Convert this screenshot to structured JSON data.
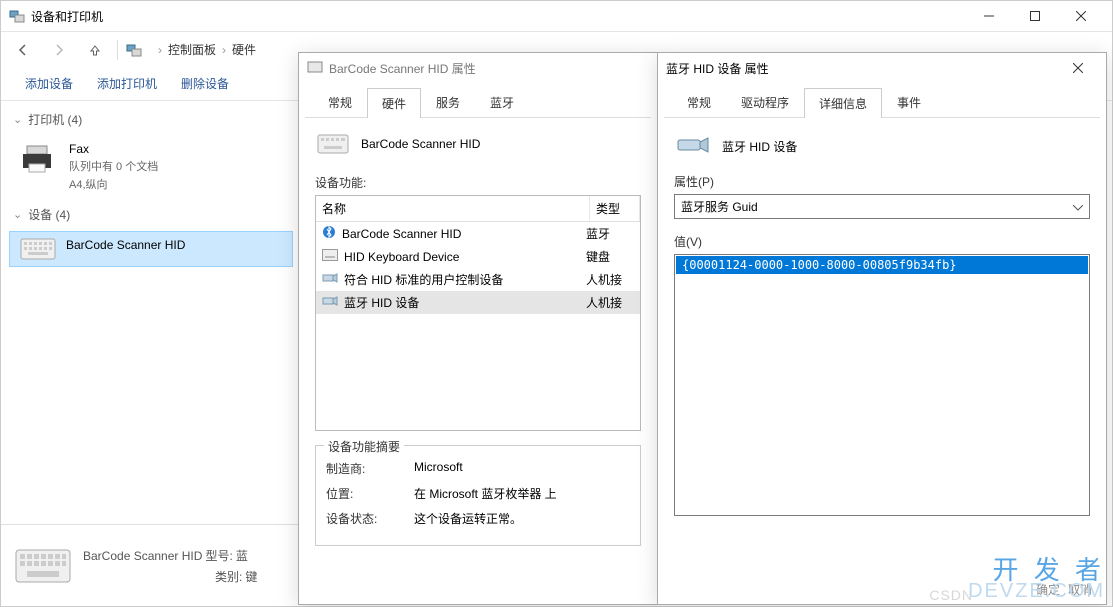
{
  "main": {
    "title": "设备和打印机",
    "breadcrumb": {
      "a": "控制面板",
      "b": "硬件"
    },
    "actions": {
      "add_device": "添加设备",
      "add_printer": "添加打印机",
      "remove_device": "删除设备"
    },
    "groups": {
      "printers": {
        "header": "打印机 (4)"
      },
      "devices": {
        "header": "设备 (4)"
      }
    },
    "printer_item": {
      "name": "Fax",
      "line2": "队列中有 0 个文档",
      "line3": "A4,纵向"
    },
    "device_item": {
      "name": "BarCode Scanner HID"
    },
    "details": {
      "name": "BarCode Scanner HID",
      "model_label": "型号:",
      "model_value": "蓝",
      "category_label": "类别:",
      "category_value": "键"
    }
  },
  "dlg1": {
    "title": "BarCode Scanner HID 属性",
    "tabs": {
      "general": "常规",
      "hardware": "硬件",
      "services": "服务",
      "bluetooth": "蓝牙"
    },
    "header": "BarCode Scanner HID",
    "section1": "设备功能:",
    "thead": {
      "name": "名称",
      "type": "类型"
    },
    "rows": [
      {
        "name": "BarCode Scanner HID",
        "type": "蓝牙",
        "icon": "bt"
      },
      {
        "name": "HID Keyboard Device",
        "type": "键盘",
        "icon": "kbd"
      },
      {
        "name": "符合 HID 标准的用户控制设备",
        "type": "人机接",
        "icon": "hid"
      },
      {
        "name": "蓝牙 HID 设备",
        "type": "人机接",
        "icon": "hid",
        "selected": true
      }
    ],
    "summary": {
      "legend": "设备功能摘要",
      "manufacturer_k": "制造商:",
      "manufacturer_v": "Microsoft",
      "location_k": "位置:",
      "location_v": "在 Microsoft 蓝牙枚举器 上",
      "status_k": "设备状态:",
      "status_v": "这个设备运转正常。"
    }
  },
  "dlg2": {
    "title": "蓝牙 HID 设备 属性",
    "tabs": {
      "general": "常规",
      "driver": "驱动程序",
      "details": "详细信息",
      "events": "事件"
    },
    "header": "蓝牙 HID 设备",
    "property_label": "属性(P)",
    "property_value": "蓝牙服务 Guid",
    "value_label": "值(V)",
    "value": "{00001124-0000-1000-8000-00805f9b34fb}",
    "ok": "确定",
    "cancel": "取消"
  },
  "watermark": {
    "top": "开 发 者",
    "bottom": "DEVZE.COM",
    "csdn": "CSDN"
  }
}
